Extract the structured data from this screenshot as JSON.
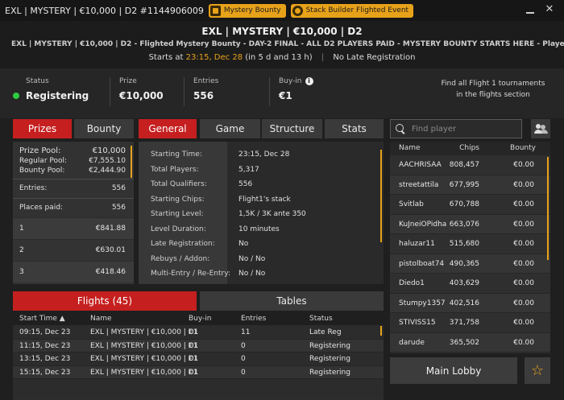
{
  "titlebar": {
    "title": "EXL | MYSTERY | €10,000 | D2 #1144906009",
    "badges": [
      "Mystery Bounty",
      "Stack Builder Flighted Event"
    ],
    "minimize_icon": "minimize-icon",
    "close_icon": "close-icon",
    "close_glyph": "✕"
  },
  "header": {
    "name": "EXL | MYSTERY | €10,000 | D2",
    "description": "EXL | MYSTERY | €10,000 | D2 - Flighted Mystery Bounty - DAY-2 FINAL - ALL D2 PLAYERS PAID - MYSTERY BOUNTY STARTS HERE -  Players can play and qualif...",
    "starts_prefix": "Starts at",
    "starts_time": "23:15, Dec 28",
    "starts_rel": "(in 5 d and 13 h)",
    "sep": "|",
    "late_reg": "No Late Registration"
  },
  "info": {
    "status_label": "Status",
    "status_value": "Registering",
    "status_color": "#2ecc40",
    "prize_label": "Prize",
    "prize_value": "€10,000",
    "entries_label": "Entries",
    "entries_value": "556",
    "buyin_label": "Buy-in",
    "buyin_value": "€1",
    "buyin_info_glyph": "i",
    "flights_note": "Find all Flight 1 tournaments in the flights section"
  },
  "left_tabs": [
    "Prizes",
    "Bounty"
  ],
  "middle_tabs": [
    "General",
    "Game",
    "Structure",
    "Stats"
  ],
  "prizes": {
    "prize_pool_label": "Prize Pool:",
    "prize_pool": "€10,000",
    "regular_label": "Regular Pool:",
    "regular": "€7,555.10",
    "bounty_label": "Bounty Pool:",
    "bounty": "€2,444.90",
    "entries_label": "Entries:",
    "entries": "556",
    "places_label": "Places paid:",
    "places": "556",
    "places_list": [
      {
        "place": "1",
        "amount": "€841.88"
      },
      {
        "place": "2",
        "amount": "€630.01"
      },
      {
        "place": "3",
        "amount": "€418.46"
      }
    ]
  },
  "general": [
    {
      "k": "Starting Time:",
      "v": "23:15, Dec 28"
    },
    {
      "k": "Total Players:",
      "v": "5,317"
    },
    {
      "k": "Total Qualifiers:",
      "v": "556"
    },
    {
      "k": "Starting Chips:",
      "v": "Flight1's stack"
    },
    {
      "k": "Starting Level:",
      "v": "1,5K / 3K ante 350"
    },
    {
      "k": "Level Duration:",
      "v": "10 minutes"
    },
    {
      "k": "Late Registration:",
      "v": "No"
    },
    {
      "k": "Rebuys / Addon:",
      "v": "No / No"
    },
    {
      "k": "Multi-Entry / Re-Entry:",
      "v": "No / No"
    }
  ],
  "search": {
    "placeholder": "Find player"
  },
  "players": {
    "headers": [
      "Name",
      "Chips",
      "Bounty"
    ],
    "rows": [
      {
        "name": "AACHRISAA",
        "chips": "808,457",
        "bounty": "€0.00"
      },
      {
        "name": "streetattila",
        "chips": "677,995",
        "bounty": "€0.00"
      },
      {
        "name": "Svitlab",
        "chips": "670,788",
        "bounty": "€0.00"
      },
      {
        "name": "KuJneiOPidha",
        "chips": "663,076",
        "bounty": "€0.00"
      },
      {
        "name": "haluzar11",
        "chips": "515,680",
        "bounty": "€0.00"
      },
      {
        "name": "pistolboat74",
        "chips": "490,365",
        "bounty": "€0.00"
      },
      {
        "name": "Diedo1",
        "chips": "403,629",
        "bounty": "€0.00"
      },
      {
        "name": "Stumpy1357",
        "chips": "402,516",
        "bounty": "€0.00"
      },
      {
        "name": "STIVISS15",
        "chips": "371,758",
        "bounty": "€0.00"
      },
      {
        "name": "darude",
        "chips": "365,502",
        "bounty": "€0.00"
      }
    ]
  },
  "bottom_tabs": [
    "Flights (45)",
    "Tables"
  ],
  "flights": {
    "headers": [
      "Start Time ▲",
      "Name",
      "Buy-in",
      "Entries",
      "Status"
    ],
    "rows": [
      {
        "time": "09:15, Dec 23",
        "name": "EXL | MYSTERY | €10,000 | D1",
        "buyin": "€1",
        "entries": "11",
        "status": "Late Reg"
      },
      {
        "time": "11:15, Dec 23",
        "name": "EXL | MYSTERY | €10,000 | D1",
        "buyin": "€1",
        "entries": "0",
        "status": "Registering"
      },
      {
        "time": "13:15, Dec 23",
        "name": "EXL | MYSTERY | €10,000 | D1",
        "buyin": "€1",
        "entries": "0",
        "status": "Registering"
      },
      {
        "time": "15:15, Dec 23",
        "name": "EXL | MYSTERY | €10,000 | D1",
        "buyin": "€1",
        "entries": "0",
        "status": "Registering"
      }
    ]
  },
  "main_lobby_label": "Main Lobby",
  "star_glyph": "☆",
  "colors": {
    "accent_red": "#c51f1f",
    "accent_orange": "#e8a21a"
  }
}
